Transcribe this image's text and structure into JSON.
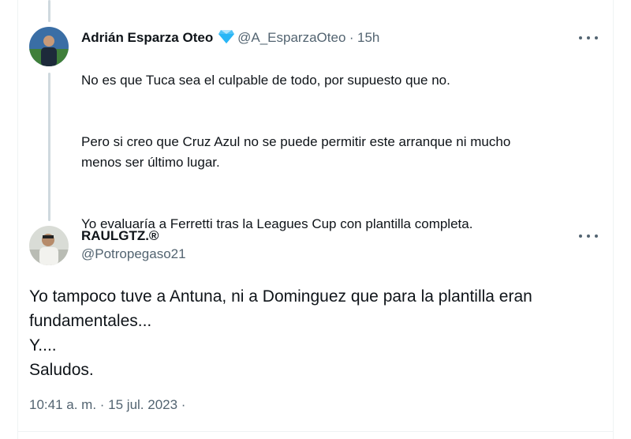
{
  "reply_tweet": {
    "author_name": "Adrián Esparza Oteo",
    "handle": "@A_EsparzaOteo",
    "separator": "·",
    "time": "15h",
    "paragraphs": [
      "No es que Tuca sea el culpable de todo, por supuesto que no.",
      "Pero si creo que Cruz Azul no se puede permitir este arranque ni mucho\nmenos ser último lugar.",
      "Yo evaluaría a Ferretti tras la Leagues Cup con plantilla completa."
    ]
  },
  "main_tweet": {
    "author_name": "RAULGTZ.®",
    "handle": "@Potropegaso21",
    "text": "Yo tampoco tuve a Antuna, ni a Dominguez que para la plantilla eran\nfundamentales...\nY....\nSaludos.",
    "timestamp": "10:41 a. m. · 15 jul. 2023 ·"
  },
  "colors": {
    "text": "#0f1419",
    "secondary": "#536471",
    "verified_badge": "#4fc3f7"
  },
  "icons": {
    "verified": "diamond-verified-icon",
    "more": "more-options-icon"
  }
}
